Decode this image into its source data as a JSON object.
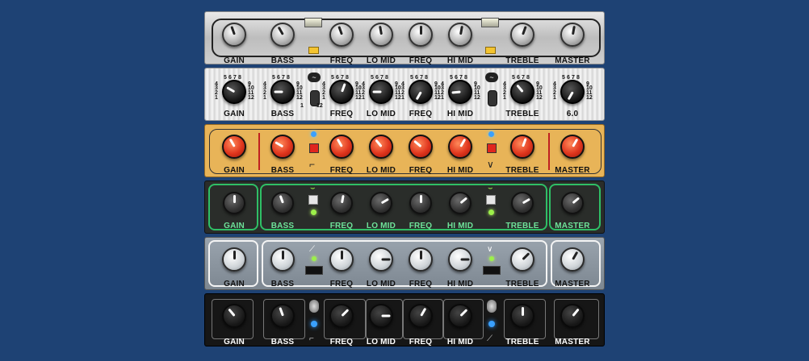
{
  "colors": {
    "background": "#1e4274",
    "led_blue": "#3aa0ff",
    "led_green": "#9cf04a",
    "button_red": "#e0261e",
    "panel_gold": "#e8b458",
    "panel_green_outline": "#2fbf66"
  },
  "panels": [
    {
      "id": "chrome",
      "labels": [
        "GAIN",
        "BASS",
        "FREQ",
        "LO MID",
        "FREQ",
        "HI MID",
        "TREBLE",
        "MASTER"
      ]
    },
    {
      "id": "silver",
      "labels": [
        "GAIN",
        "BASS",
        "FREQ",
        "LO MID",
        "FREQ",
        "HI MID",
        "TREBLE",
        "6.0"
      ],
      "scale_top": [
        "5",
        "6",
        "7",
        "8"
      ],
      "scale_left": [
        "4",
        "3",
        "2",
        "1"
      ],
      "scale_right": [
        "9",
        "10",
        "11",
        "12"
      ]
    },
    {
      "id": "gold",
      "labels": [
        "GAIN",
        "BASS",
        "FREQ",
        "LO MID",
        "FREQ",
        "HI MID",
        "TREBLE",
        "MASTER"
      ]
    },
    {
      "id": "green",
      "labels": [
        "GAIN",
        "BASS",
        "FREQ",
        "LO MID",
        "FREQ",
        "HI MID",
        "TREBLE",
        "MASTER"
      ]
    },
    {
      "id": "grey",
      "labels": [
        "GAIN",
        "BASS",
        "FREQ",
        "LO MID",
        "FREQ",
        "HI MID",
        "TREBLE",
        "MASTER"
      ]
    },
    {
      "id": "black",
      "labels": [
        "GAIN",
        "BASS",
        "FREQ",
        "LO MID",
        "FREQ",
        "HI MID",
        "TREBLE",
        "MASTER"
      ]
    }
  ]
}
